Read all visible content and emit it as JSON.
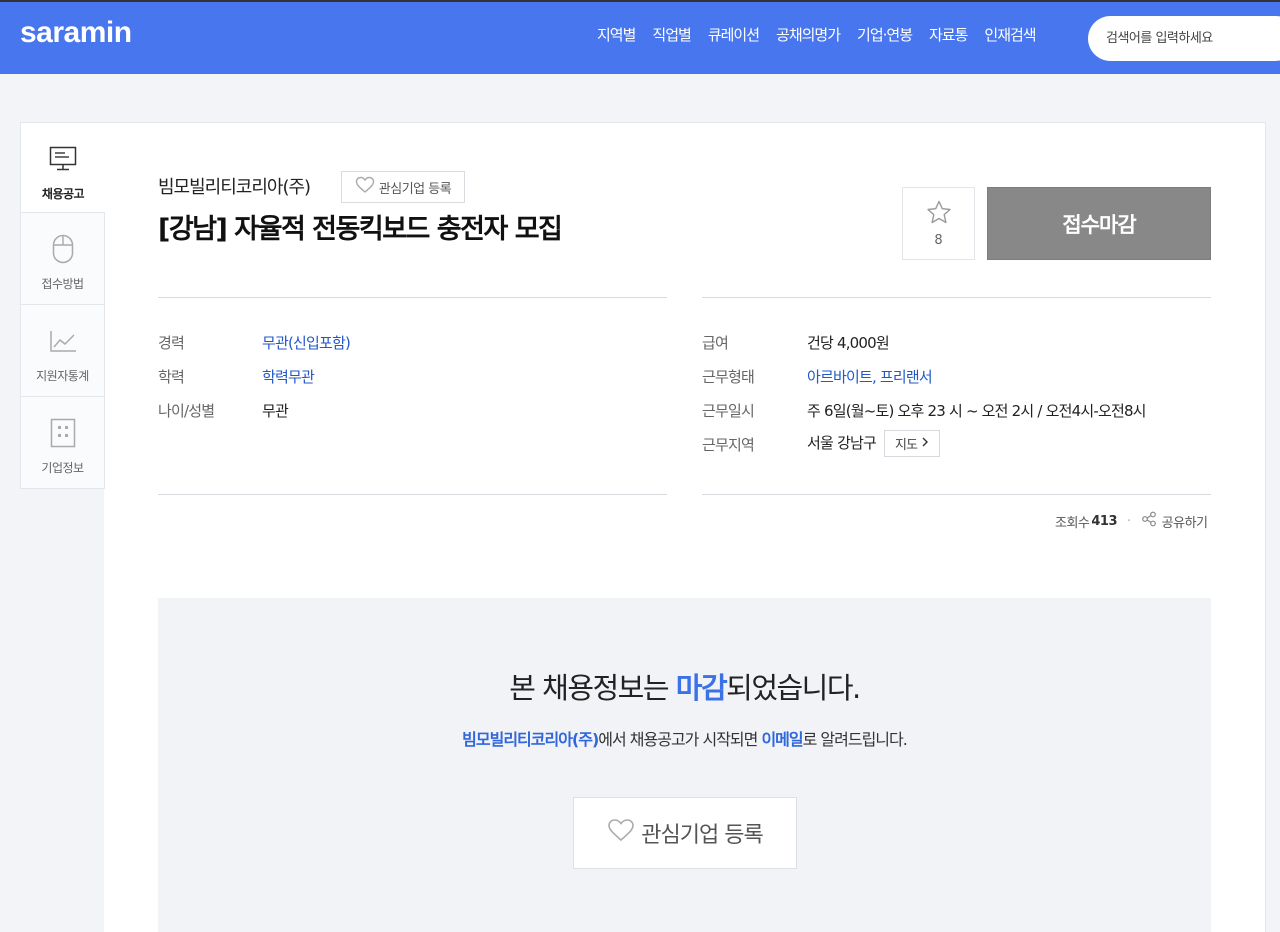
{
  "header": {
    "logo": "saramin",
    "nav": [
      "지역별",
      "직업별",
      "큐레이션",
      "공채의명가",
      "기업·연봉",
      "자료통",
      "인재검색"
    ],
    "search_placeholder": "검색어를 입력하세요"
  },
  "sidenav": [
    {
      "label": "채용공고",
      "icon": "monitor-icon"
    },
    {
      "label": "접수방법",
      "icon": "mouse-icon"
    },
    {
      "label": "지원자통계",
      "icon": "chart-icon"
    },
    {
      "label": "기업정보",
      "icon": "building-icon"
    }
  ],
  "job": {
    "company": "빔모빌리티코리아(주)",
    "fav_label": "관심기업 등록",
    "title": "[강남] 자율적 전동킥보드 충전자 모집",
    "star_count": "8",
    "status_button": "접수마감"
  },
  "details_left": [
    {
      "label": "경력",
      "value": "무관(신입포함)",
      "link": true
    },
    {
      "label": "학력",
      "value": "학력무관",
      "link": true
    },
    {
      "label": "나이/성별",
      "value": "무관",
      "link": false
    }
  ],
  "details_right": [
    {
      "label": "급여",
      "value": "건당 4,000원",
      "link": false
    },
    {
      "label": "근무형태",
      "value": "아르바이트, 프리랜서",
      "link": true
    },
    {
      "label": "근무일시",
      "value": "주 6일(월~토) 오후 23 시 ~ 오전 2시 / 오전4시-오전8시",
      "link": false
    },
    {
      "label": "근무지역",
      "value": "서울 강남구",
      "link": false
    }
  ],
  "map_button": "지도",
  "stats": {
    "views_label": "조회수",
    "views": "413",
    "share_label": "공유하기"
  },
  "closed": {
    "msg_before": "본 채용정보는 ",
    "msg_highlight": "마감",
    "msg_after": "되었습니다.",
    "sub_company": "빔모빌리티코리아(주)",
    "sub_middle": "에서 채용공고가 시작되면 ",
    "sub_email": "이메일",
    "sub_after": "로 알려드립니다.",
    "fav_button": "관심기업 등록"
  },
  "colors": {
    "brand": "#4876ef",
    "link": "#2258c9",
    "closed_button": "#888888"
  }
}
